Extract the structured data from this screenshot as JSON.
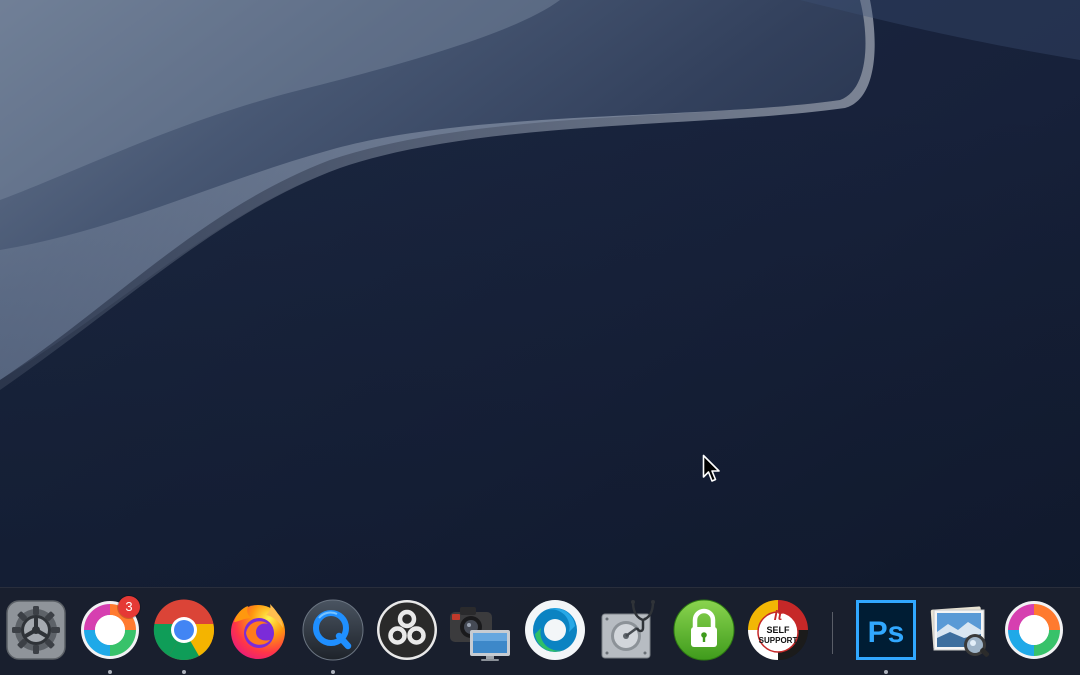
{
  "dock": {
    "items": [
      {
        "name": "System Preferences",
        "icon": "gear-icon",
        "running": false
      },
      {
        "name": "Webex Teams",
        "icon": "webex-teams-icon",
        "running": true,
        "badge": "3"
      },
      {
        "name": "Google Chrome",
        "icon": "chrome-icon",
        "running": true
      },
      {
        "name": "Firefox",
        "icon": "firefox-icon",
        "running": false
      },
      {
        "name": "QuickTime Player",
        "icon": "quicktime-icon",
        "running": true
      },
      {
        "name": "OBS",
        "icon": "obs-icon",
        "running": false
      },
      {
        "name": "Image Capture",
        "icon": "image-capture-icon",
        "running": false
      },
      {
        "name": "Webex Meetings",
        "icon": "webex-meetings-icon",
        "running": false
      },
      {
        "name": "Disk Utility",
        "icon": "disk-utility-icon",
        "running": false
      },
      {
        "name": "Keychain Lock",
        "icon": "padlock-icon",
        "running": false
      },
      {
        "name": "IT Self Support",
        "icon": "it-self-support-icon",
        "running": false,
        "logo_text": [
          "it",
          "SELF",
          "SUPPORT"
        ]
      },
      {
        "name": "Photoshop",
        "icon": "photoshop-icon",
        "running": true,
        "logo_text": "Ps"
      },
      {
        "name": "Preview",
        "icon": "preview-icon",
        "running": false
      },
      {
        "name": "Webex",
        "icon": "webex-icon",
        "running": false
      }
    ]
  },
  "colors": {
    "desktop_bg": "#162037",
    "badge": "#e53935",
    "photoshop_blue": "#31a8ff",
    "padlock_green": "#5cb82e"
  }
}
